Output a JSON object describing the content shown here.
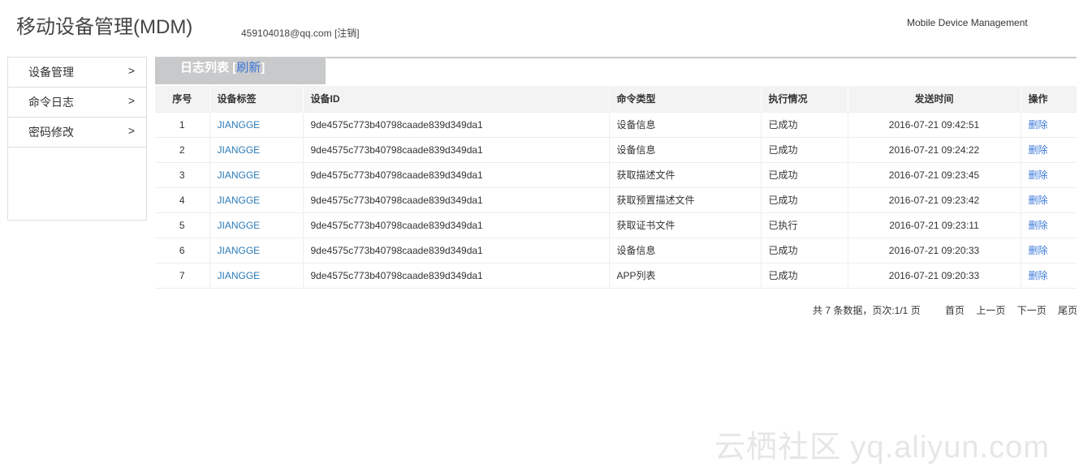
{
  "header": {
    "title": "移动设备管理(MDM)",
    "user_email": "459104018@qq.com",
    "logout_label": "[注销]",
    "subtitle": "Mobile Device Management"
  },
  "sidebar": {
    "items": [
      {
        "label": "设备管理",
        "chevron": ">"
      },
      {
        "label": "命令日志",
        "chevron": ">"
      },
      {
        "label": "密码修改",
        "chevron": ">"
      }
    ]
  },
  "panel": {
    "title": "日志列表",
    "refresh_open": "[",
    "refresh_label": "刷新",
    "refresh_close": "]"
  },
  "table": {
    "headers": [
      "序号",
      "设备标签",
      "设备ID",
      "命令类型",
      "执行情况",
      "发送时间",
      "操作"
    ],
    "rows": [
      {
        "no": "1",
        "tag": "JIANGGE",
        "id": "9de4575c773b40798caade839d349da1",
        "cmd": "设备信息",
        "status": "已成功",
        "time": "2016-07-21 09:42:51",
        "action": "删除"
      },
      {
        "no": "2",
        "tag": "JIANGGE",
        "id": "9de4575c773b40798caade839d349da1",
        "cmd": "设备信息",
        "status": "已成功",
        "time": "2016-07-21 09:24:22",
        "action": "删除"
      },
      {
        "no": "3",
        "tag": "JIANGGE",
        "id": "9de4575c773b40798caade839d349da1",
        "cmd": "获取描述文件",
        "status": "已成功",
        "time": "2016-07-21 09:23:45",
        "action": "删除"
      },
      {
        "no": "4",
        "tag": "JIANGGE",
        "id": "9de4575c773b40798caade839d349da1",
        "cmd": "获取预置描述文件",
        "status": "已成功",
        "time": "2016-07-21 09:23:42",
        "action": "删除"
      },
      {
        "no": "5",
        "tag": "JIANGGE",
        "id": "9de4575c773b40798caade839d349da1",
        "cmd": "获取证书文件",
        "status": "已执行",
        "time": "2016-07-21 09:23:11",
        "action": "删除"
      },
      {
        "no": "6",
        "tag": "JIANGGE",
        "id": "9de4575c773b40798caade839d349da1",
        "cmd": "设备信息",
        "status": "已成功",
        "time": "2016-07-21 09:20:33",
        "action": "删除"
      },
      {
        "no": "7",
        "tag": "JIANGGE",
        "id": "9de4575c773b40798caade839d349da1",
        "cmd": "APP列表",
        "status": "已成功",
        "time": "2016-07-21 09:20:33",
        "action": "删除"
      }
    ]
  },
  "pager": {
    "summary": "共 7 条数据，页次:1/1 页",
    "first": "首页",
    "prev": "上一页",
    "next": "下一页",
    "last": "尾页"
  },
  "watermark": "云栖社区 yq.aliyun.com"
}
